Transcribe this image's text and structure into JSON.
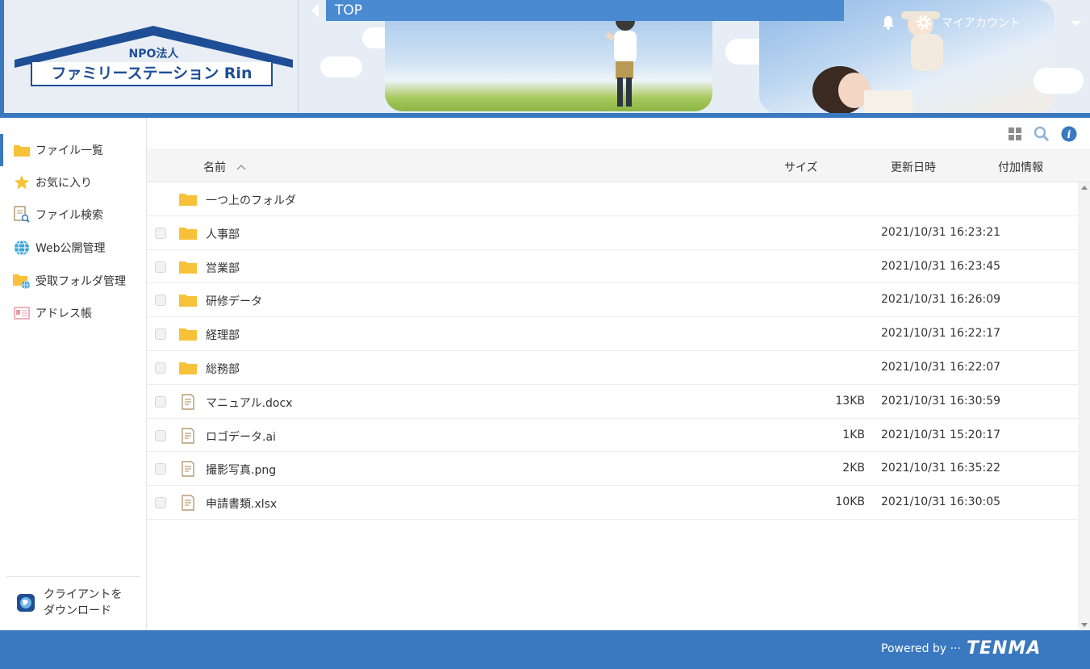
{
  "logo": {
    "sub": "NPO法人",
    "main": "ファミリーステーション Rin"
  },
  "header": {
    "breadcrumb": "TOP",
    "account_label": "マイアカウント"
  },
  "sidebar": {
    "items": [
      {
        "label": "ファイル一覧",
        "icon": "folder-icon"
      },
      {
        "label": "お気に入り",
        "icon": "star-icon"
      },
      {
        "label": "ファイル検索",
        "icon": "file-search-icon"
      },
      {
        "label": "Web公開管理",
        "icon": "globe-icon"
      },
      {
        "label": "受取フォルダ管理",
        "icon": "folder-globe-icon"
      },
      {
        "label": "アドレス帳",
        "icon": "address-card-icon"
      }
    ],
    "client_label_1": "クライアントを",
    "client_label_2": "ダウンロード"
  },
  "table": {
    "headers": {
      "name": "名前",
      "size": "サイズ",
      "modified": "更新日時",
      "info": "付加情報"
    },
    "parent_folder": "一つ上のフォルダ",
    "rows": [
      {
        "name": "人事部",
        "type": "folder",
        "size": "",
        "modified": "2021/10/31 16:23:21"
      },
      {
        "name": "営業部",
        "type": "folder",
        "size": "",
        "modified": "2021/10/31 16:23:45"
      },
      {
        "name": "研修データ",
        "type": "folder",
        "size": "",
        "modified": "2021/10/31 16:26:09"
      },
      {
        "name": "経理部",
        "type": "folder",
        "size": "",
        "modified": "2021/10/31 16:22:17"
      },
      {
        "name": "総務部",
        "type": "folder",
        "size": "",
        "modified": "2021/10/31 16:22:07"
      },
      {
        "name": "マニュアル.docx",
        "type": "file",
        "size": "13KB",
        "modified": "2021/10/31 16:30:59"
      },
      {
        "name": "ロゴデータ.ai",
        "type": "file",
        "size": "1KB",
        "modified": "2021/10/31 15:20:17"
      },
      {
        "name": "撮影写真.png",
        "type": "file",
        "size": "2KB",
        "modified": "2021/10/31 16:35:22"
      },
      {
        "name": "申請書類.xlsx",
        "type": "file",
        "size": "10KB",
        "modified": "2021/10/31 16:30:05"
      }
    ]
  },
  "footer": {
    "powered": "Powered by ···",
    "brand": "TENMA"
  },
  "colors": {
    "accent": "#3a78c0",
    "folder": "#f7c23a",
    "topbar": "#4a8ad0"
  }
}
